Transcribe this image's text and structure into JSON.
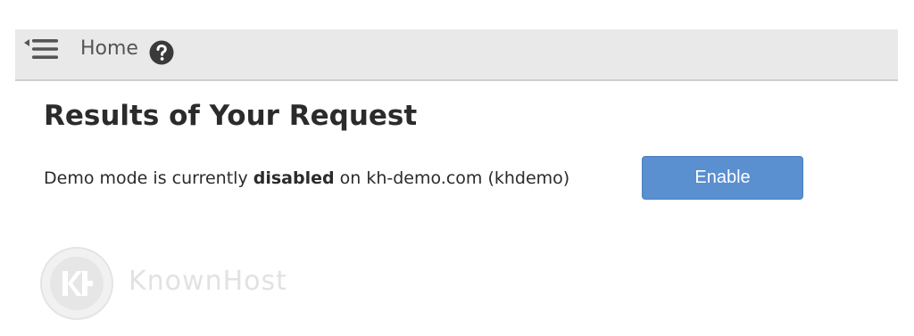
{
  "header": {
    "breadcrumb_home": "Home",
    "menu_icon": "menu-collapse-icon",
    "help_icon": "question-circle-icon"
  },
  "main": {
    "title": "Results of Your Request",
    "status": {
      "prefix": "Demo mode is currently ",
      "state": "disabled",
      "suffix": " on kh-demo.com (khdemo)"
    },
    "enable_label": "Enable"
  },
  "watermark": {
    "text": "KnownHost"
  },
  "colors": {
    "accent": "#5a8fd0",
    "topbar": "#e9e9e9"
  }
}
